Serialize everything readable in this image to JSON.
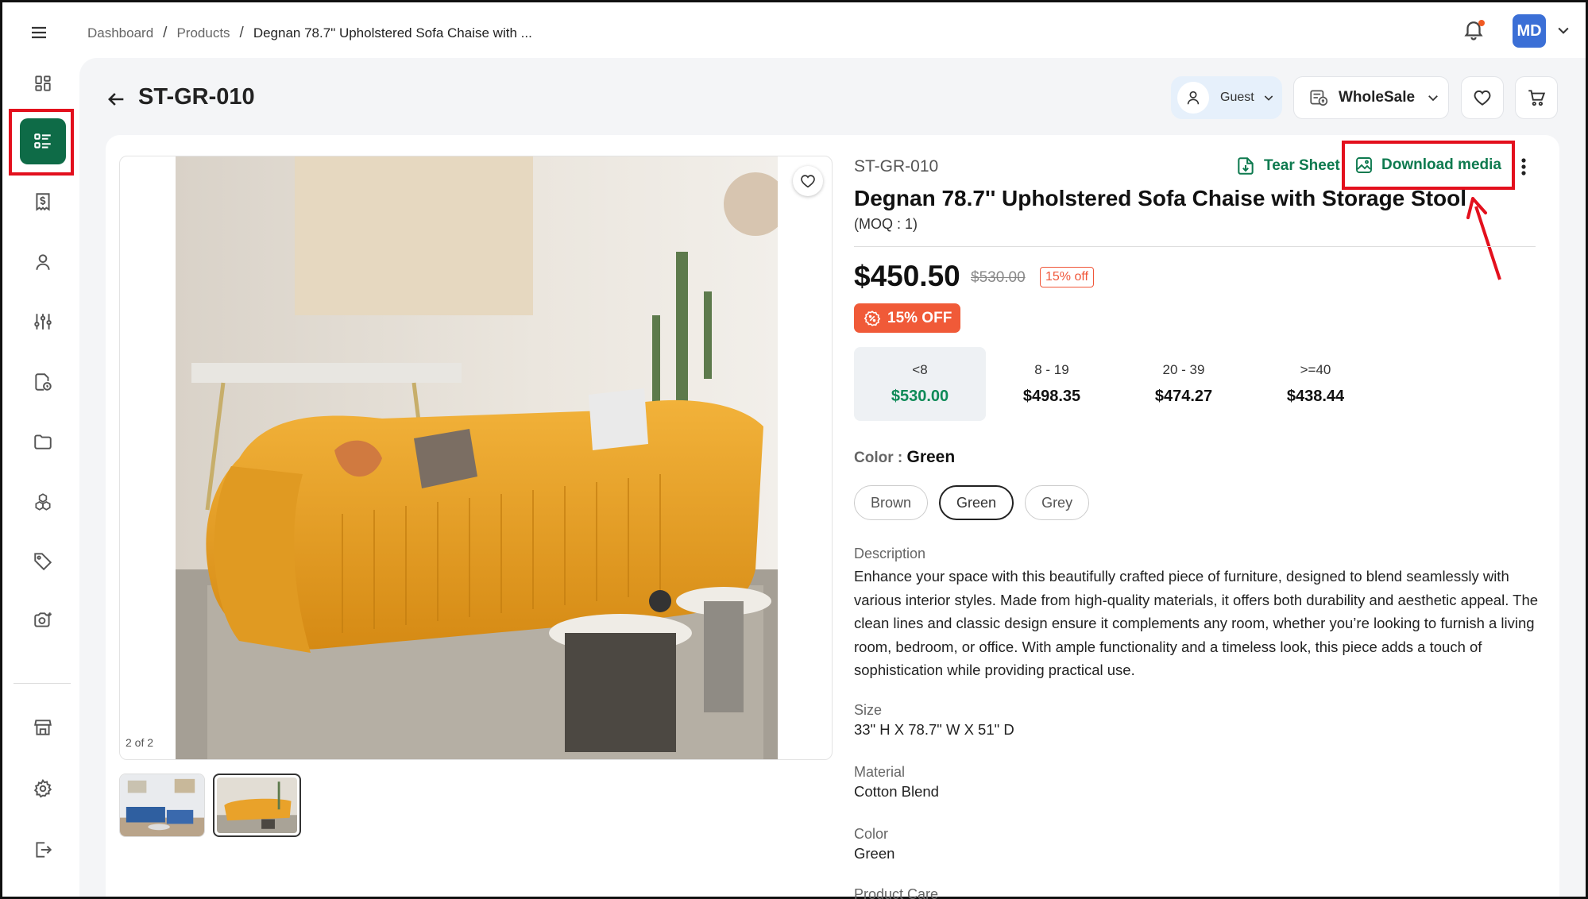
{
  "breadcrumb": [
    "Dashboard",
    "Products",
    "Degnan 78.7\" Upholstered Sofa Chaise with ..."
  ],
  "user": {
    "initials": "MD"
  },
  "page": {
    "title": "ST-GR-010"
  },
  "header_controls": {
    "guest_label": "Guest",
    "pricing_label": "WholeSale"
  },
  "sidebar": {
    "items": [
      "menu",
      "dashboard",
      "products",
      "invoices",
      "customers",
      "filters",
      "reports",
      "folders",
      "inventory",
      "tags",
      "camera",
      "store",
      "settings",
      "logout"
    ],
    "active": "products"
  },
  "gallery": {
    "counter": "2 of 2",
    "current": 2,
    "total": 2
  },
  "product": {
    "sku": "ST-GR-010",
    "title": "Degnan 78.7'' Upholstered Sofa Chaise with Storage Stool",
    "moq": "(MOQ : 1)",
    "price": "$450.50",
    "old_price": "$530.00",
    "off_tag": "15% off",
    "off_badge": "15% OFF",
    "tear_sheet": "Tear Sheet",
    "download_media": "Download media",
    "tiers": [
      {
        "qty": "<8",
        "price": "$530.00"
      },
      {
        "qty": "8 - 19",
        "price": "$498.35"
      },
      {
        "qty": "20 - 39",
        "price": "$474.27"
      },
      {
        "qty": ">=40",
        "price": "$438.44"
      }
    ],
    "color_label": "Color :",
    "color_value": "Green",
    "color_options": [
      "Brown",
      "Green",
      "Grey"
    ],
    "description_label": "Description",
    "description": "Enhance your space with this beautifully crafted piece of furniture, designed to blend seamlessly with various interior styles. Made from high-quality materials, it offers both durability and aesthetic appeal. The clean lines and classic design ensure it complements any room, whether you’re looking to furnish a living room, bedroom, or office. With ample functionality and a timeless look, this piece adds a touch of sophistication while providing practical use.",
    "size_label": "Size",
    "size": "33\" H X 78.7\" W X 51\" D",
    "material_label": "Material",
    "material": "Cotton Blend",
    "color2_label": "Color",
    "color2": "Green",
    "care_label": "Product Care"
  },
  "colors": {
    "brand_green": "#0e6b47",
    "accent_orange": "#f05a38",
    "annotation_red": "#e3101d"
  }
}
